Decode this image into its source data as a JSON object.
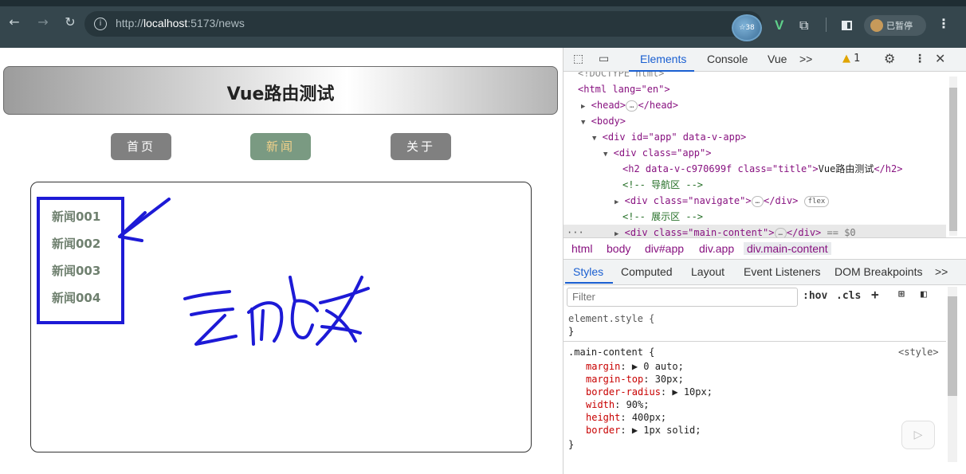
{
  "browser": {
    "url_prefix": "http://",
    "url_host": "localhost",
    "url_rest": ":5173/news",
    "ext_badge": "38",
    "ext_vue": "V",
    "profile_label": "已暂停"
  },
  "page": {
    "title": "Vue路由测试",
    "nav": [
      {
        "label": "首页",
        "active": false
      },
      {
        "label": "新闻",
        "active": true
      },
      {
        "label": "关于",
        "active": false
      }
    ],
    "news": [
      "新闻001",
      "新闻002",
      "新闻003",
      "新闻004"
    ]
  },
  "devtools": {
    "tabs": [
      "Elements",
      "Console",
      "Vue",
      ">>"
    ],
    "warning_count": "1",
    "dom": {
      "doctype": "<!DOCTYPE html>",
      "html_open": "<html lang=\"en\">",
      "head": "<head>",
      "head_close": "</head>",
      "body_open": "<body>",
      "div_app": "<div id=\"app\" data-v-app>",
      "div_class_app": "<div class=\"app\">",
      "h2_open": "<h2 data-v-c970699f class=\"title\">",
      "h2_text": "Vue路由测试",
      "h2_close": "</h2>",
      "comment_nav": "<!-- 导航区 -->",
      "div_navigate": "<div class=\"navigate\">",
      "div_navigate_close": "</div>",
      "flex_badge": "flex",
      "comment_show": "<!-- 展示区 -->",
      "div_main": "<div class=\"main-content\">",
      "div_main_close": "</div>",
      "selected_marker": "== $0"
    },
    "breadcrumbs": [
      "html",
      "body",
      "div#app",
      "div.app",
      "div.main-content"
    ],
    "sub_tabs": [
      "Styles",
      "Computed",
      "Layout",
      "Event Listeners",
      "DOM Breakpoints",
      ">>"
    ],
    "filter_placeholder": "Filter",
    "filter_tools": [
      ":hov",
      ".cls"
    ],
    "styles": {
      "element_style": "element.style {",
      "close_brace": "}",
      "rule_selector": ".main-content {",
      "rule_source": "<style>",
      "props": [
        {
          "name": "margin",
          "value": "▶ 0 auto;"
        },
        {
          "name": "margin-top",
          "value": "30px;"
        },
        {
          "name": "border-radius",
          "value": "▶ 10px;"
        },
        {
          "name": "width",
          "value": "90%;"
        },
        {
          "name": "height",
          "value": "400px;"
        },
        {
          "name": "border",
          "value": "▶ 1px solid;"
        }
      ]
    }
  },
  "colors": {
    "annotation": "#1d1ad6",
    "nav_active_bg": "#7a9a82",
    "nav_active_text": "#f2d18a",
    "news_text": "#6f806f"
  }
}
